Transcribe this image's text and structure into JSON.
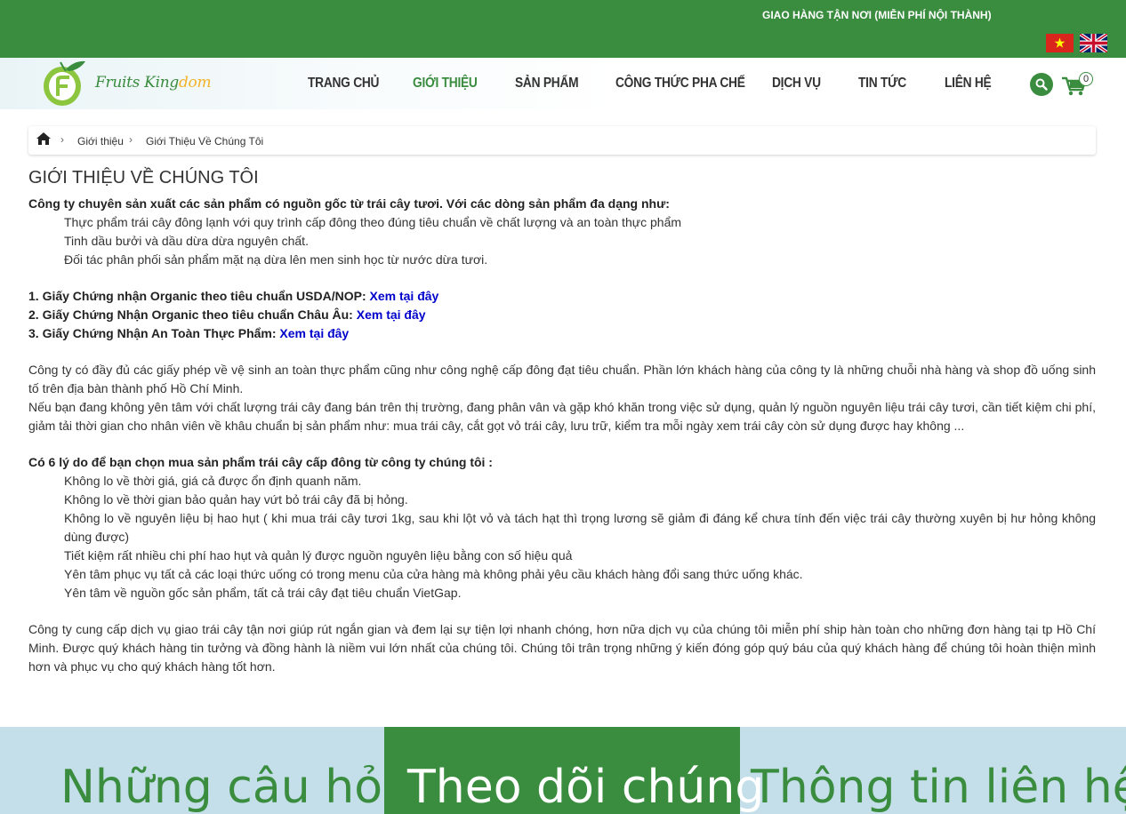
{
  "topbar": {
    "shipping_notice": "GIAO HÀNG TẬN NƠI (MIỄN PHÍ NỘI THÀNH)",
    "languages": [
      "vn-flag-icon",
      "uk-flag-icon"
    ]
  },
  "logo": {
    "part1": "Fruits King",
    "part2": "dom"
  },
  "nav": {
    "items": [
      "TRANG CHỦ",
      "GIỚI THIỆU",
      "SẢN PHẨM",
      "CÔNG THỨC PHA CHẾ",
      "DỊCH VỤ",
      "TIN TỨC",
      "LIÊN HỆ"
    ],
    "active": "GIỚI THIỆU",
    "cart_count": "0"
  },
  "breadcrumb": {
    "home_icon": "home-icon",
    "items": [
      "Giới thiệu",
      "Giới Thiệu Về Chúng Tôi"
    ]
  },
  "content": {
    "title": "GIỚI THIỆU VỀ CHÚNG TÔI",
    "intro": "Công ty chuyên sản xuất các sản phẩm có nguồn gốc từ trái cây tươi. Với các dòng sản phẩm đa dạng như:",
    "products": [
      "Thực phẩm trái cây đông lạnh với quy trình cấp đông theo đúng tiêu chuẩn về chất lượng và an toàn thực phẩm",
      "Tinh dầu bưởi và dầu dừa dừa nguyên chất.",
      "Đối tác phân phối sản phẩm mặt nạ dừa lên men sinh học từ nước dừa tươi."
    ],
    "certificates": [
      {
        "label": "1. Giấy Chứng nhận Organic theo tiêu chuẩn USDA/NOP: ",
        "link": "Xem tại đây"
      },
      {
        "label": "2. Giấy Chứng Nhận Organic theo tiêu chuẩn Châu Âu: ",
        "link": "Xem tại đây"
      },
      {
        "label": "3. Giấy Chứng Nhận An Toàn Thực Phẩm: ",
        "link": "Xem tại đây"
      }
    ],
    "para1": "Công ty có đầy đủ các giấy phép về vệ sinh an toàn thực phẩm cũng như công nghệ cấp đông đạt tiêu chuẩn. Phần lớn khách hàng của công ty là những chuỗi nhà hàng và shop đồ uống sinh tố trên địa bàn thành phố Hồ Chí Minh.",
    "para2": "Nếu bạn đang không yên tâm với chất lượng trái cây đang bán trên thị trường, đang phân vân và gặp khó khăn trong việc sử dụng, quản lý nguồn nguyên liệu trái cây tươi, cần tiết kiệm chi phí, giảm tải thời gian cho nhân viên về khâu chuẩn bị sản phẩm như: mua trái cây, cắt gọt vỏ trái cây, lưu trữ, kiểm tra mỗi ngày xem trái cây còn sử dụng được hay không ...",
    "reasons_title": "Có 6 lý do để bạn chọn mua sản phẩm trái cây cấp đông từ công ty chúng tôi :",
    "reasons": [
      "Không lo về thời giá, giá cả được ổn định quanh năm.",
      "Không lo về thời gian bảo quản hay vứt bỏ trái cây đã bị hỏng.",
      "Không lo về nguyên liệu bị hao hụt ( khi mua trái cây tươi 1kg, sau khi lột vỏ và tách hạt thì trọng lương sẽ giảm đi đáng kể chưa tính đến việc trái cây thường xuyên bị hư hỏng không dùng được)",
      "Tiết kiệm rất nhiều chi phí hao hụt  và quản lý được nguồn nguyên liệu bằng con số hiệu quả",
      "Yên tâm phục vụ tất cả các loại thức uống có trong menu của cửa hàng mà không phải yêu cầu khách hàng đổi sang thức uống khác.",
      "Yên tâm về nguồn gốc sản phẩm, tất cả trái cây đạt tiêu chuẩn VietGap."
    ],
    "para3": "Công ty cung cấp dịch vụ giao trái cây tận nơi giúp rút ngắn gian và đem lại sự tiện lợi nhanh chóng, hơn nữa dịch vụ của chúng tôi miễn phí ship hàn toàn cho những đơn hàng tại tp Hồ Chí Minh. Được quý khách hàng tin tưởng và đồng hành là niềm vui lớn nhất của chúng tôi. Chúng tôi trân trọng những ý kiến đóng góp quý báu của quý khách hàng để chúng tôi hoàn thiện mình hơn và phục vụ cho quý khách hàng tốt hơn."
  },
  "footer": {
    "col1": "Những câu hỏi",
    "col2": "Theo dõi chúng",
    "col3": "Thông tin liên hệ"
  },
  "colors": {
    "brand_green": "#3a8c3f",
    "footer_blue": "#c4dfe9",
    "link_blue": "#0000cc",
    "logo_accent": "#f2b32b"
  }
}
